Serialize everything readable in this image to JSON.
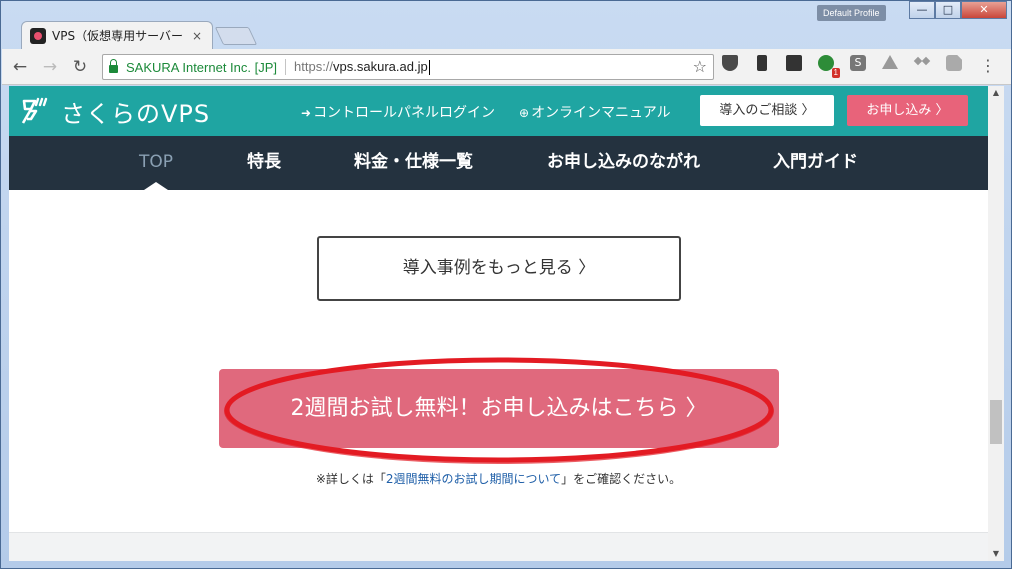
{
  "browser": {
    "tab_title": "VPS（仮想専用サーバー",
    "tab_close": "×",
    "profile": "Default Profile",
    "window_buttons": {
      "minimize": "—",
      "maximize": "□",
      "close": "✕"
    },
    "nav": {
      "back": "←",
      "forward": "→",
      "reload": "↻"
    },
    "ev_name": "SAKURA Internet Inc. [JP]",
    "url_scheme": "https://",
    "url_host": "vps.sakura.ad.jp",
    "bookmark_star": "☆",
    "extensions": [
      "pocket-icon",
      "phone-extension-icon",
      "evernote-icon",
      "green-extension-icon",
      "s-extension-icon",
      "drive-icon",
      "dropbox-icon",
      "pdf-icon"
    ],
    "extension_badge": "1",
    "s_ext_label": "S",
    "menu": "⋮"
  },
  "site": {
    "logo_text": "さくらのVPS",
    "header_links": {
      "control_panel": "コントロールパネルログイン",
      "manual": "オンラインマニュアル"
    },
    "consult_button": "導入のご相談 〉",
    "apply_button": "お申し込み 〉",
    "nav": {
      "top": "TOP",
      "features": "特長",
      "pricing": "料金・仕様一覧",
      "flow": "お申し込みのながれ",
      "guide": "入門ガイド"
    },
    "more_cases_button": "導入事例をもっと見る 〉",
    "trial_button": "2週間お試し無料！お申し込みはこちら 〉",
    "note_prefix": "※詳しくは「",
    "note_link": "2週間無料のお試し期間について",
    "note_suffix": "」をご確認ください。"
  },
  "scrollbar": {
    "up": "▲",
    "down": "▼"
  },
  "colors": {
    "header_teal": "#1fa5a2",
    "nav_dark": "#24323f",
    "apply_pink": "#e8637a",
    "trial_pink": "#e0697d",
    "annotation_red": "#e31b23"
  }
}
